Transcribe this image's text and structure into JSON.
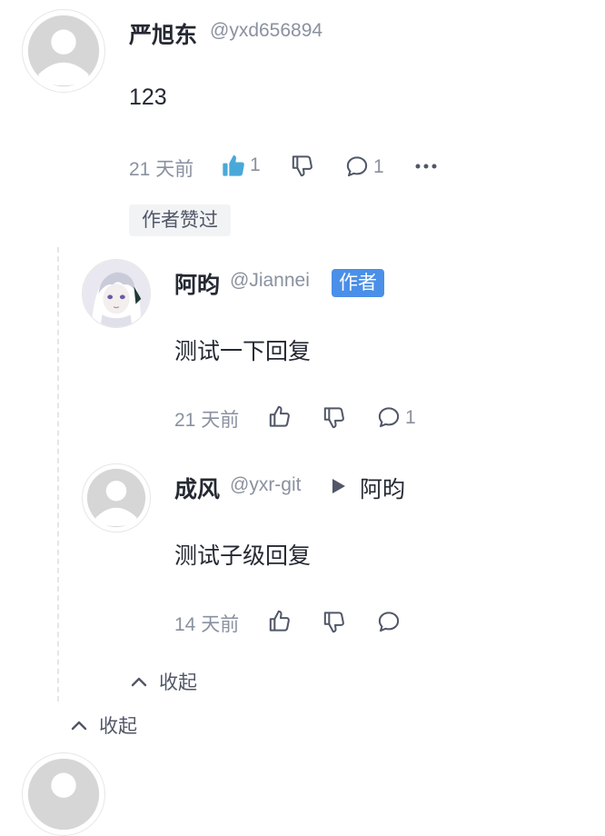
{
  "comment": {
    "author": "严旭东",
    "handle": "@yxd656894",
    "content": "123",
    "time": "21 天前",
    "like_count": "1",
    "reply_count": "1",
    "liked_by_author_label": "作者赞过",
    "replies": [
      {
        "author": "阿昀",
        "handle": "@Jiannei",
        "badge": "作者",
        "content": "测试一下回复",
        "time": "21 天前",
        "reply_count": "1"
      },
      {
        "author": "成风",
        "handle": "@yxr-git",
        "reply_to": "阿昀",
        "content": "测试子级回复",
        "time": "14 天前"
      }
    ],
    "inner_collapse_label": "收起",
    "outer_collapse_label": "收起"
  },
  "colors": {
    "accent": "#4aa8d8",
    "author_badge": "#4a8fe8",
    "muted": "#8a919f"
  },
  "icons": [
    "default-avatar-icon",
    "anime-avatar-icon",
    "thumb-up-filled-icon",
    "thumb-up-icon",
    "thumb-down-icon",
    "comment-icon",
    "more-icon",
    "play-triangle-icon",
    "chevron-up-icon"
  ]
}
